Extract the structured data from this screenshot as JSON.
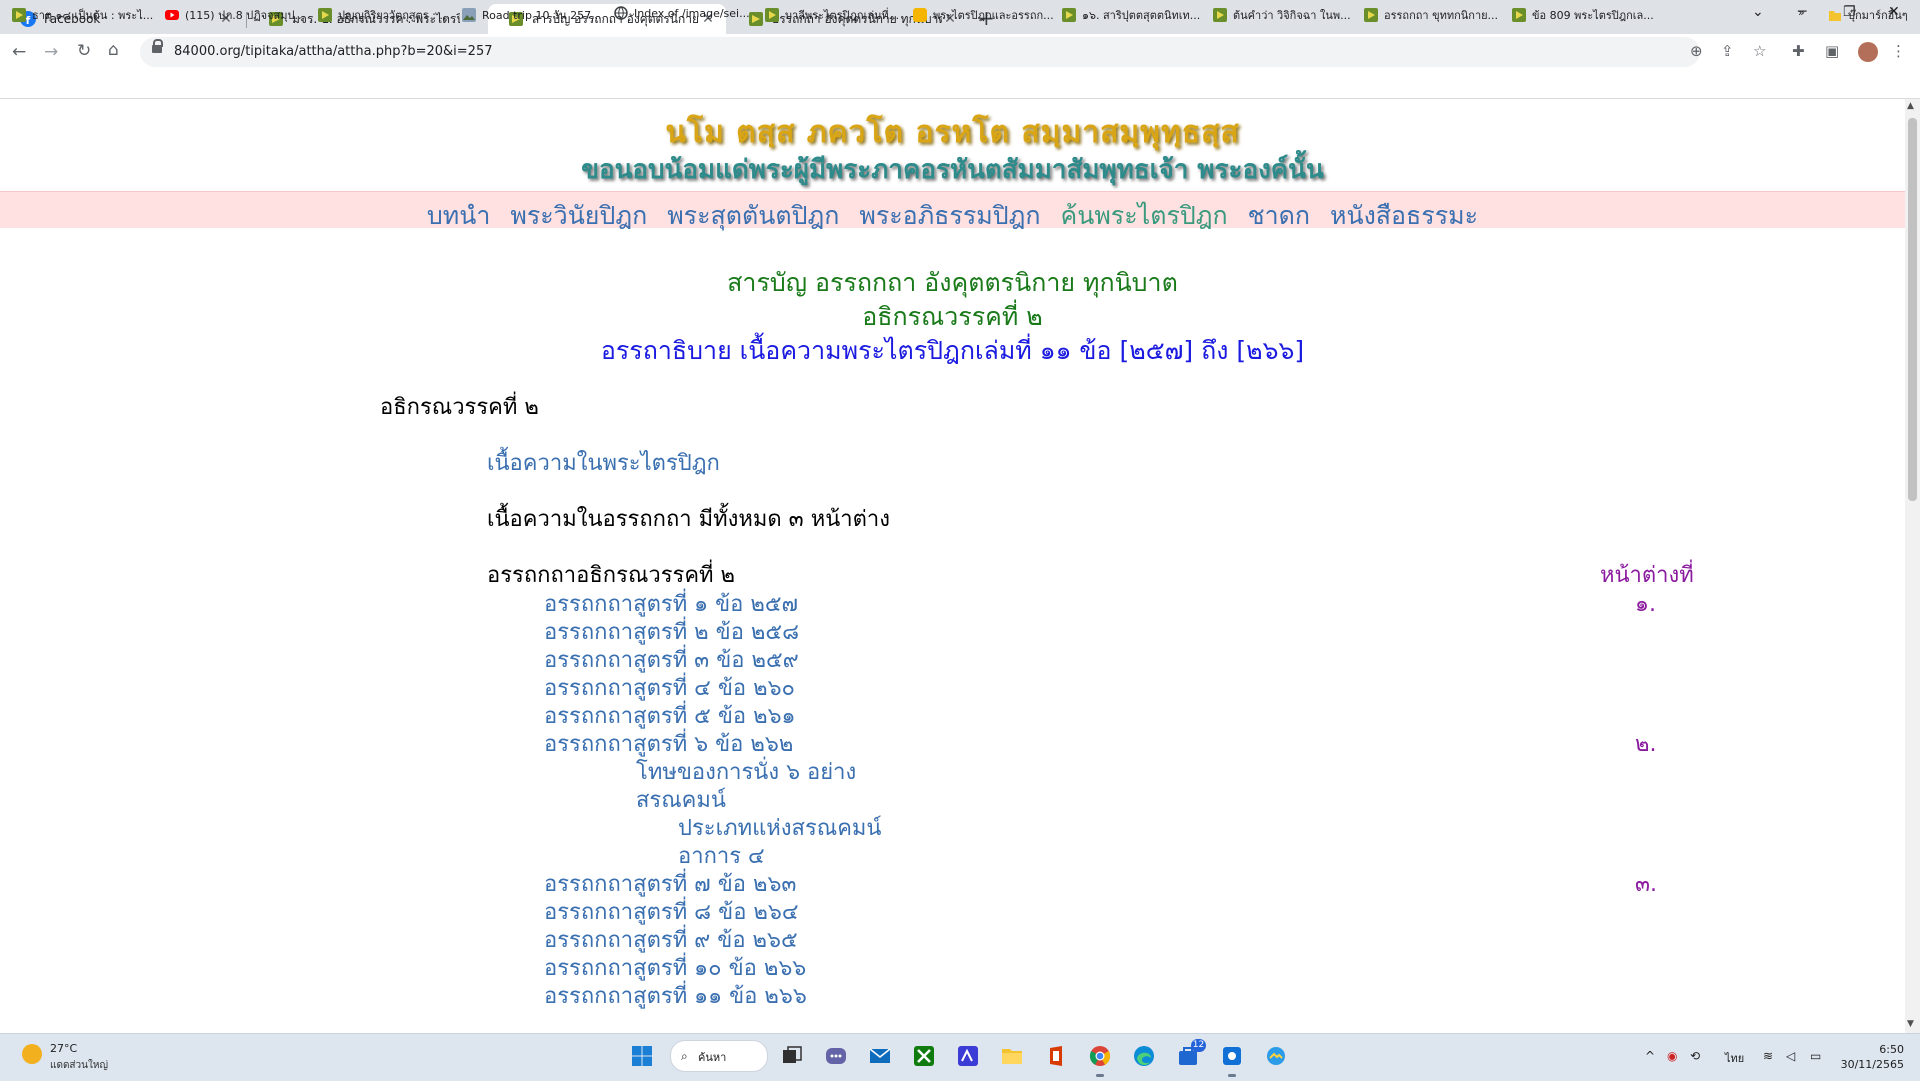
{
  "browser": {
    "tabs": [
      {
        "title": "Facebook",
        "icon": "facebook-icon"
      },
      {
        "title": "มจร. ๒. อธิกรณวรรค : พระไตรปิฎกเล่ม",
        "icon": "tipitaka-icon"
      },
      {
        "title": "สารบัญ อรรถกถา อังคุตตรนิกาย ทุกนิ",
        "icon": "tipitaka-icon"
      },
      {
        "title": "อรรถกถา อังคุตตรนิกาย ทุกนิบาต ปฐม",
        "icon": "tipitaka-icon"
      }
    ],
    "active_tab": 2,
    "url": "84000.org/tipitaka/attha/attha.php?b=20&i=257",
    "bookmarks": [
      "ธาตุ ๑๘ เป็นต้น : พระไ...",
      "(115) ปภ.8 ปฏิจจสมุป...",
      "ปุญญกิริยาวัตถุสูตร : ...",
      "Road trip 10 วัน 257...",
      "Index of /image/sei...",
      "บาลีพระไตรปิฎกเล่มที่...",
      "พระไตรปิฎกและอรรถก...",
      "๑๖. สาริปุตตสุตตนิทเท...",
      "ต้นคำว่า วิจิกิจฉา ในพ...",
      "อรรถกถา ขุททกนิกาย...",
      "ข้อ 809 พระไตรปิฎกเล..."
    ],
    "other_bookmarks": "บุ๊กมาร์กอื่นๆ",
    "more_bookmarks": "»"
  },
  "site": {
    "header_pali": "นโม ตสฺส ภควโต อรหโต สมฺมาสมฺพุทฺธสฺส",
    "header_thai": "ขอนอบน้อมแด่พระผู้มีพระภาคอรหันตสัมมาสัมพุทธเจ้า  พระองค์นั้น",
    "nav": [
      "บทนำ",
      "พระวินัยปิฎก",
      "พระสุตตันตปิฎก",
      "พระอภิธรรมปิฎก",
      "ค้นพระไตรปิฎก",
      "ชาดก",
      "หนังสือธรรมะ"
    ],
    "nav_current_index": 4
  },
  "content": {
    "title_line1": "สารบัญ อรรถกถา อังคุตตรนิกาย ทุกนิบาต",
    "title_line2": "อธิกรณวรรคที่ ๒",
    "title_line3": "อรรถาธิบาย เนื้อความพระไตรปิฎกเล่มที่ ๑๑ ข้อ [๒๕๗] ถึง [๒๖๖]",
    "section_heading": "อธิกรณวรรคที่ ๒",
    "sutta_link": "เนื้อความในพระไตรปิฎก",
    "attha_count": "เนื้อความในอรรถกถา มีทั้งหมด ๓ หน้าต่าง",
    "attha_heading": "อรรถกถาอธิกรณวรรคที่ ๒",
    "window_label": "หน้าต่างที่",
    "entries": [
      {
        "text": "อรรถกถาสูตรที่ ๑ ข้อ ๒๕๗",
        "indent": 1,
        "window": "๑."
      },
      {
        "text": "อรรถกถาสูตรที่ ๒ ข้อ ๒๕๘",
        "indent": 1,
        "window": ""
      },
      {
        "text": "อรรถกถาสูตรที่ ๓ ข้อ ๒๕๙",
        "indent": 1,
        "window": ""
      },
      {
        "text": "อรรถกถาสูตรที่ ๔ ข้อ ๒๖๐",
        "indent": 1,
        "window": ""
      },
      {
        "text": "อรรถกถาสูตรที่ ๕ ข้อ ๒๖๑",
        "indent": 1,
        "window": ""
      },
      {
        "text": "อรรถกถาสูตรที่ ๖ ข้อ ๒๖๒",
        "indent": 1,
        "window": "๒."
      },
      {
        "text": "โทษของการนั่ง ๖ อย่าง",
        "indent": 2,
        "window": ""
      },
      {
        "text": "สรณคมน์",
        "indent": 2,
        "window": ""
      },
      {
        "text": "ประเภทแห่งสรณคมน์",
        "indent": 3,
        "window": ""
      },
      {
        "text": "อาการ ๔",
        "indent": 3,
        "window": ""
      },
      {
        "text": "อรรถกถาสูตรที่ ๗ ข้อ ๒๖๓",
        "indent": 1,
        "window": "๓."
      },
      {
        "text": "อรรถกถาสูตรที่ ๘ ข้อ ๒๖๔",
        "indent": 1,
        "window": ""
      },
      {
        "text": "อรรถกถาสูตรที่ ๙ ข้อ ๒๖๕",
        "indent": 1,
        "window": ""
      },
      {
        "text": "อรรถกถาสูตรที่ ๑๐ ข้อ ๒๖๖",
        "indent": 1,
        "window": ""
      },
      {
        "text": "อรรถกถาสูตรที่ ๑๑ ข้อ ๒๖๖",
        "indent": 1,
        "window": ""
      }
    ]
  },
  "taskbar": {
    "weather_temp": "27°C",
    "weather_desc": "แดดส่วนใหญ่",
    "search_label": "ค้นหา",
    "mail_badge": "12",
    "language": "ไทย",
    "time": "6:50",
    "date": "30/11/2565"
  },
  "colors": {
    "nav_bar_bg": "#ffe1e1",
    "header_gold": "#d9a514",
    "title_green": "#1a7a1a",
    "title_blue": "#1a1ae0",
    "link_blue": "#3a6fb0",
    "window_purple": "#8a1a9e"
  }
}
